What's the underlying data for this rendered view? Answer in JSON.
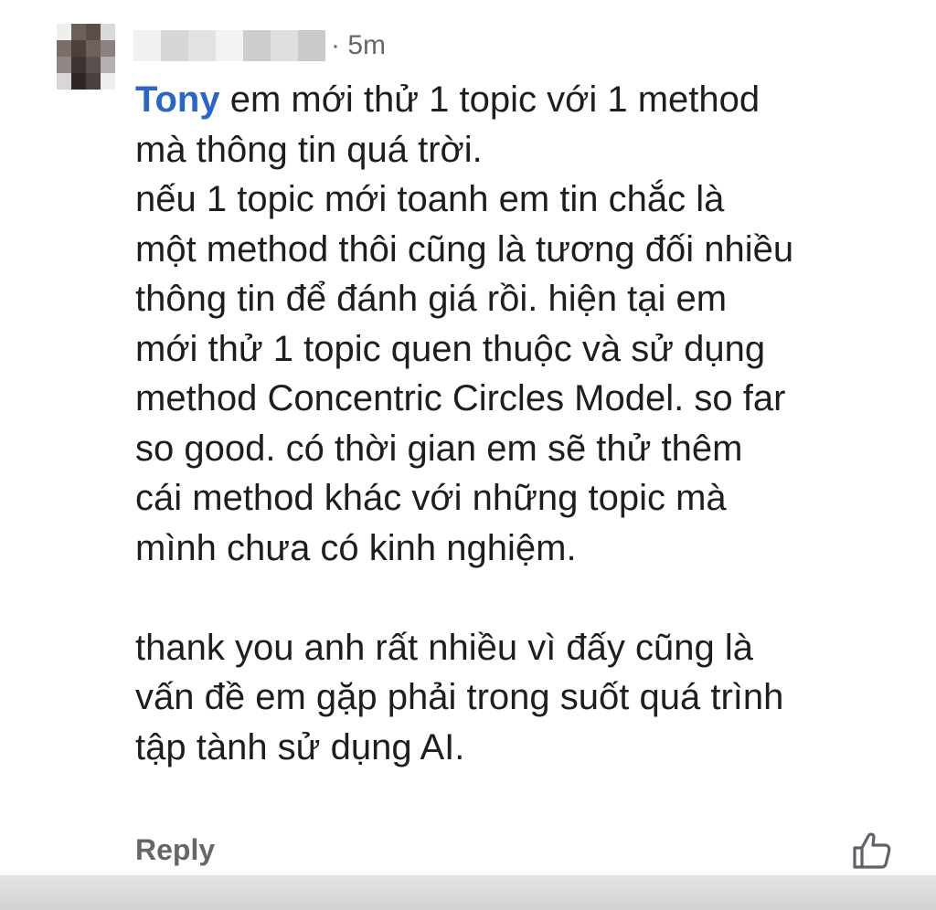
{
  "comment": {
    "timestamp": "· 5m",
    "mention": "Tony",
    "lines": [
      " em mới thử 1 topic với 1 method",
      "mà thông tin quá trời.",
      "nếu 1 topic mới toanh em tin chắc là",
      "một method thôi cũng là tương đối nhiều",
      "thông tin để đánh giá rồi. hiện tại em",
      "mới thử 1 topic quen thuộc và sử dụng",
      "method Concentric Circles Model. so far",
      "so good. có thời gian em sẽ thử thêm",
      "cái method khác với những topic mà",
      "mình chưa có kinh nghiệm."
    ],
    "lines2": [
      "thank you anh rất nhiều vì đấy cũng là",
      "vấn đề em gặp phải trong suốt quá trình",
      "tập tành sử dụng AI."
    ]
  },
  "actions": {
    "reply_label": "Reply",
    "like_icon": "thumbs-up-icon"
  },
  "colors": {
    "mention": "#2a66c8",
    "meta": "#65676b",
    "text": "#1c1e21"
  }
}
